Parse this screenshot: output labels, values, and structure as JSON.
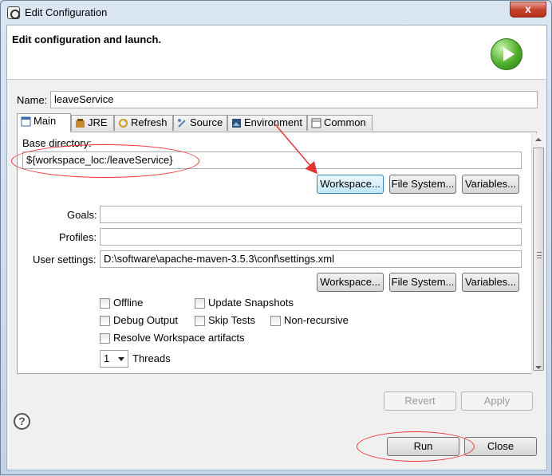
{
  "window": {
    "title": "Edit Configuration",
    "close_label": "x"
  },
  "banner": {
    "heading": "Edit configuration and launch."
  },
  "name_field": {
    "label": "Name:",
    "value": "leaveService"
  },
  "tabs": [
    {
      "label": "Main",
      "icon": "main-tab-icon"
    },
    {
      "label": "JRE",
      "icon": "jre-icon"
    },
    {
      "label": "Refresh",
      "icon": "refresh-icon"
    },
    {
      "label": "Source",
      "icon": "source-icon"
    },
    {
      "label": "Environment",
      "icon": "environment-icon"
    },
    {
      "label": "Common",
      "icon": "common-icon"
    }
  ],
  "main": {
    "base_dir_label": "Base directory:",
    "base_dir_value": "${workspace_loc:/leaveService}",
    "buttons_top": {
      "workspace": "Workspace...",
      "file_system": "File System...",
      "variables": "Variables..."
    },
    "goals_label": "Goals:",
    "goals_value": "",
    "profiles_label": "Profiles:",
    "profiles_value": "",
    "user_settings_label": "User settings:",
    "user_settings_value": "D:\\software\\apache-maven-3.5.3\\conf\\settings.xml",
    "buttons_bottom": {
      "workspace": "Workspace...",
      "file_system": "File System...",
      "variables": "Variables..."
    },
    "checkboxes": {
      "offline": "Offline",
      "update_snapshots": "Update Snapshots",
      "debug_output": "Debug Output",
      "skip_tests": "Skip Tests",
      "non_recursive": "Non-recursive",
      "resolve_workspace": "Resolve Workspace artifacts"
    },
    "threads_value": "1",
    "threads_label": "Threads"
  },
  "actions": {
    "revert": "Revert",
    "apply": "Apply",
    "run": "Run",
    "close": "Close"
  },
  "help_symbol": "?",
  "colors": {
    "annotation": "#e33333",
    "client_bg": "#f0f0f0"
  }
}
